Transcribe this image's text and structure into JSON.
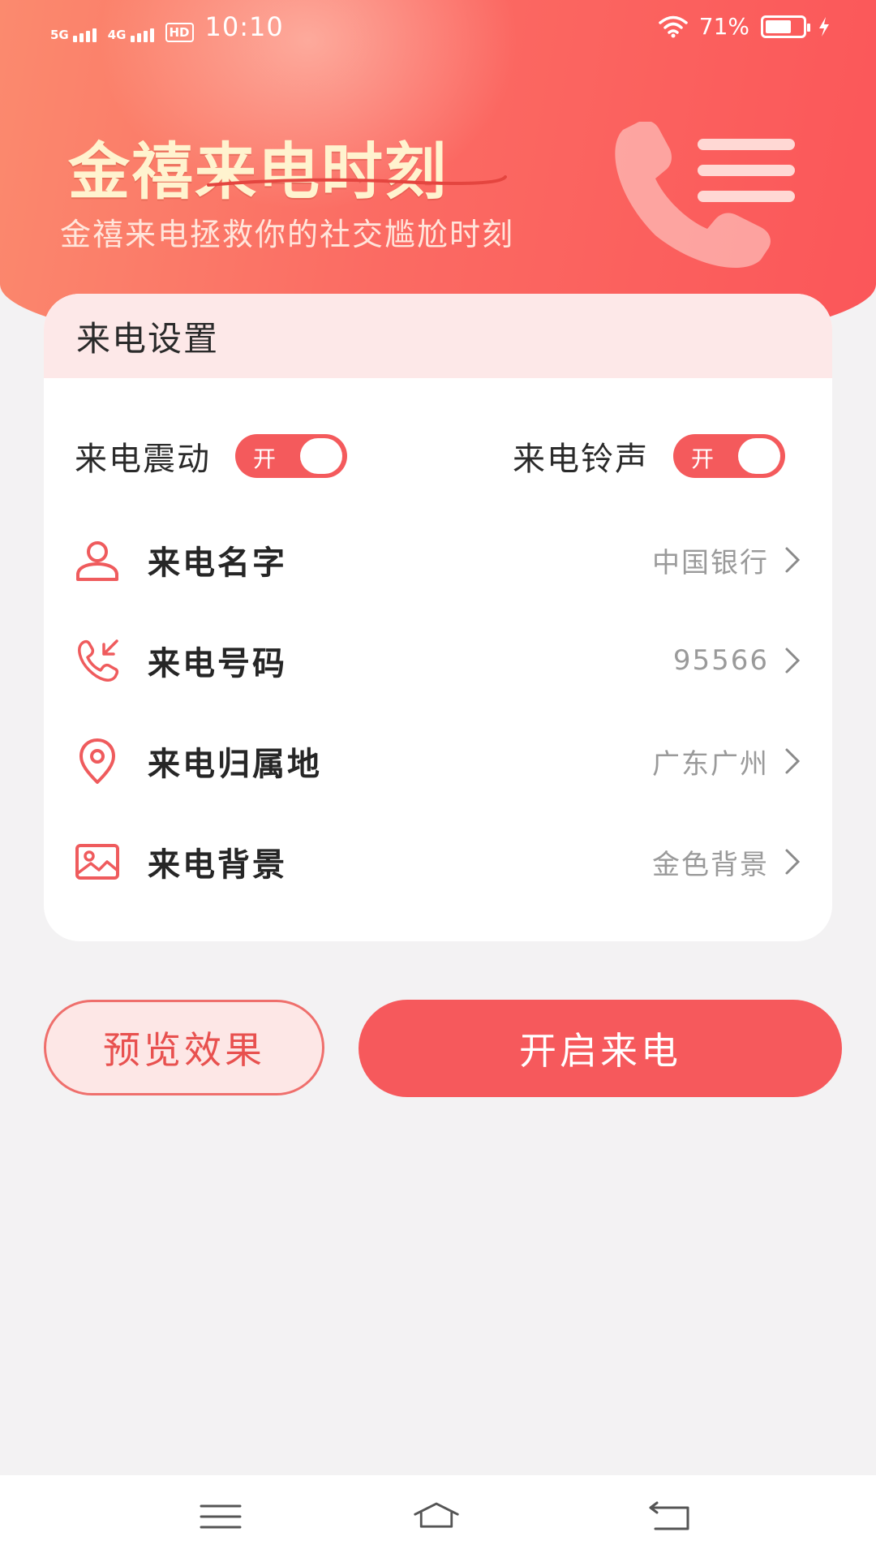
{
  "status_bar": {
    "network1": "5G",
    "network2": "4G",
    "hd": "HD",
    "time": "10:10",
    "battery": "71%",
    "battery_level": 0.71
  },
  "header": {
    "title": "金禧来电时刻",
    "subtitle": "金禧来电拯救你的社交尴尬时刻",
    "icons": [
      "phone-decoration-icon",
      "menu-icon"
    ]
  },
  "settings": {
    "section_title": "来电设置",
    "vibration": {
      "label": "来电震动",
      "state": "开"
    },
    "ringtone": {
      "label": "来电铃声",
      "state": "开"
    },
    "rows": [
      {
        "icon": "person-icon",
        "label": "来电名字",
        "value": "中国银行"
      },
      {
        "icon": "incoming-call-icon",
        "label": "来电号码",
        "value": "95566"
      },
      {
        "icon": "location-pin-icon",
        "label": "来电归属地",
        "value": "广东广州"
      },
      {
        "icon": "image-icon",
        "label": "来电背景",
        "value": "金色背景"
      }
    ]
  },
  "actions": {
    "preview": "预览效果",
    "start": "开启来电"
  },
  "colors": {
    "accent": "#f6595c",
    "header_start": "#fb8a6e",
    "header_end": "#fb5659",
    "card_header": "#fde8e8",
    "muted_text": "#9a9a9a"
  },
  "nav": {
    "icons": [
      "recent-apps-icon",
      "home-icon",
      "back-icon"
    ]
  }
}
